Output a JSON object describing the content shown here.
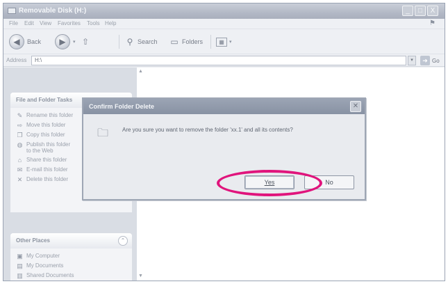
{
  "window": {
    "title": "Removable Disk (H:)",
    "controls": [
      "_",
      "□",
      "X"
    ]
  },
  "menu": {
    "items": [
      "File",
      "Edit",
      "View",
      "Favorites",
      "Tools",
      "Help"
    ]
  },
  "toolbar": {
    "back_label": "Back",
    "search_label": "Search",
    "folders_label": "Folders"
  },
  "address": {
    "label": "Address",
    "value": "H:\\",
    "go_label": "Go"
  },
  "tasks_panel": {
    "title": "File and Folder Tasks",
    "items": [
      "Rename this folder",
      "Move this folder",
      "Copy this folder",
      "Publish this folder to the Web",
      "Share this folder",
      "E-mail this folder",
      "Delete this folder"
    ]
  },
  "places_panel": {
    "title": "Other Places",
    "items": [
      "My Computer",
      "My Documents",
      "Shared Documents"
    ]
  },
  "dialog": {
    "title": "Confirm Folder Delete",
    "message": "Are you sure you want to remove the folder 'xx.1' and all its contents?",
    "yes_label": "Yes",
    "no_label": "No"
  },
  "colors": {
    "highlight_ring": "#e0147c",
    "dialog_title_bg": "#8892a3"
  }
}
